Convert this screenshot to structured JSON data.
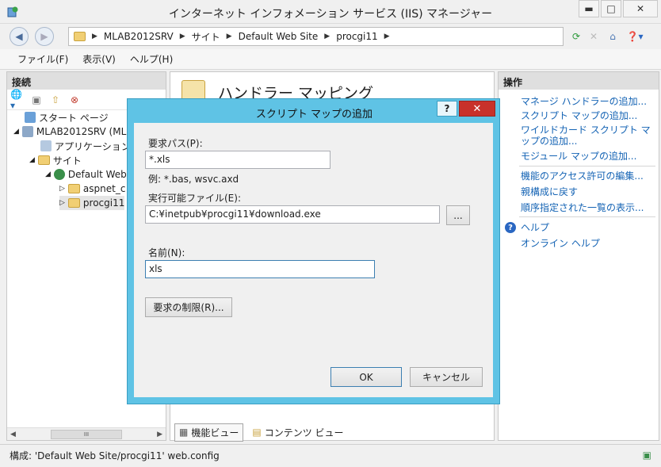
{
  "window": {
    "title": "インターネット インフォメーション サービス (IIS) マネージャー",
    "min_glyph": "▬",
    "max_glyph": "□",
    "close_glyph": "✕"
  },
  "address": {
    "crumbs": [
      "MLAB2012SRV",
      "サイト",
      "Default Web Site",
      "procgi11"
    ]
  },
  "menu": {
    "file": "ファイル(F)",
    "view": "表示(V)",
    "help": "ヘルプ(H)"
  },
  "connections": {
    "header": "接続",
    "tree": {
      "start_page": "スタート ページ",
      "server": "MLAB2012SRV (ML",
      "app_pools": "アプリケーション プー",
      "sites": "サイト",
      "default_site": "Default Web",
      "aspnet": "aspnet_c",
      "procgi": "procgi11"
    },
    "scroll_thumb": "III"
  },
  "center": {
    "title": "ハンドラー マッピング",
    "tab_features": "機能ビュー",
    "tab_content": "コンテンツ ビュー"
  },
  "actions": {
    "header": "操作",
    "items": [
      "マネージ ハンドラーの追加...",
      "スクリプト マップの追加...",
      "ワイルドカード スクリプト マップの追加...",
      "モジュール マップの追加..."
    ],
    "items2": [
      "機能のアクセス許可の編集...",
      "親構成に戻す",
      "順序指定された一覧の表示..."
    ],
    "help": "ヘルプ",
    "online_help": "オンライン ヘルプ"
  },
  "status": {
    "text": "構成: 'Default Web Site/procgi11' web.config"
  },
  "dialog": {
    "title": "スクリプト マップの追加",
    "help_glyph": "?",
    "close_glyph": "✕",
    "request_path_label": "要求パス(P):",
    "request_path_value": "*.xls",
    "example": "例: *.bas, wsvc.axd",
    "executable_label": "実行可能ファイル(E):",
    "executable_value": "C:¥inetpub¥procgi11¥download.exe",
    "browse_label": "...",
    "name_label": "名前(N):",
    "name_value": "xls",
    "restrictions_label": "要求の制限(R)...",
    "ok_label": "OK",
    "cancel_label": "キャンセル"
  },
  "colors": {
    "dialog_frame": "#5fc3e5",
    "close_red": "#c8312a",
    "link_blue": "#1463b4"
  }
}
